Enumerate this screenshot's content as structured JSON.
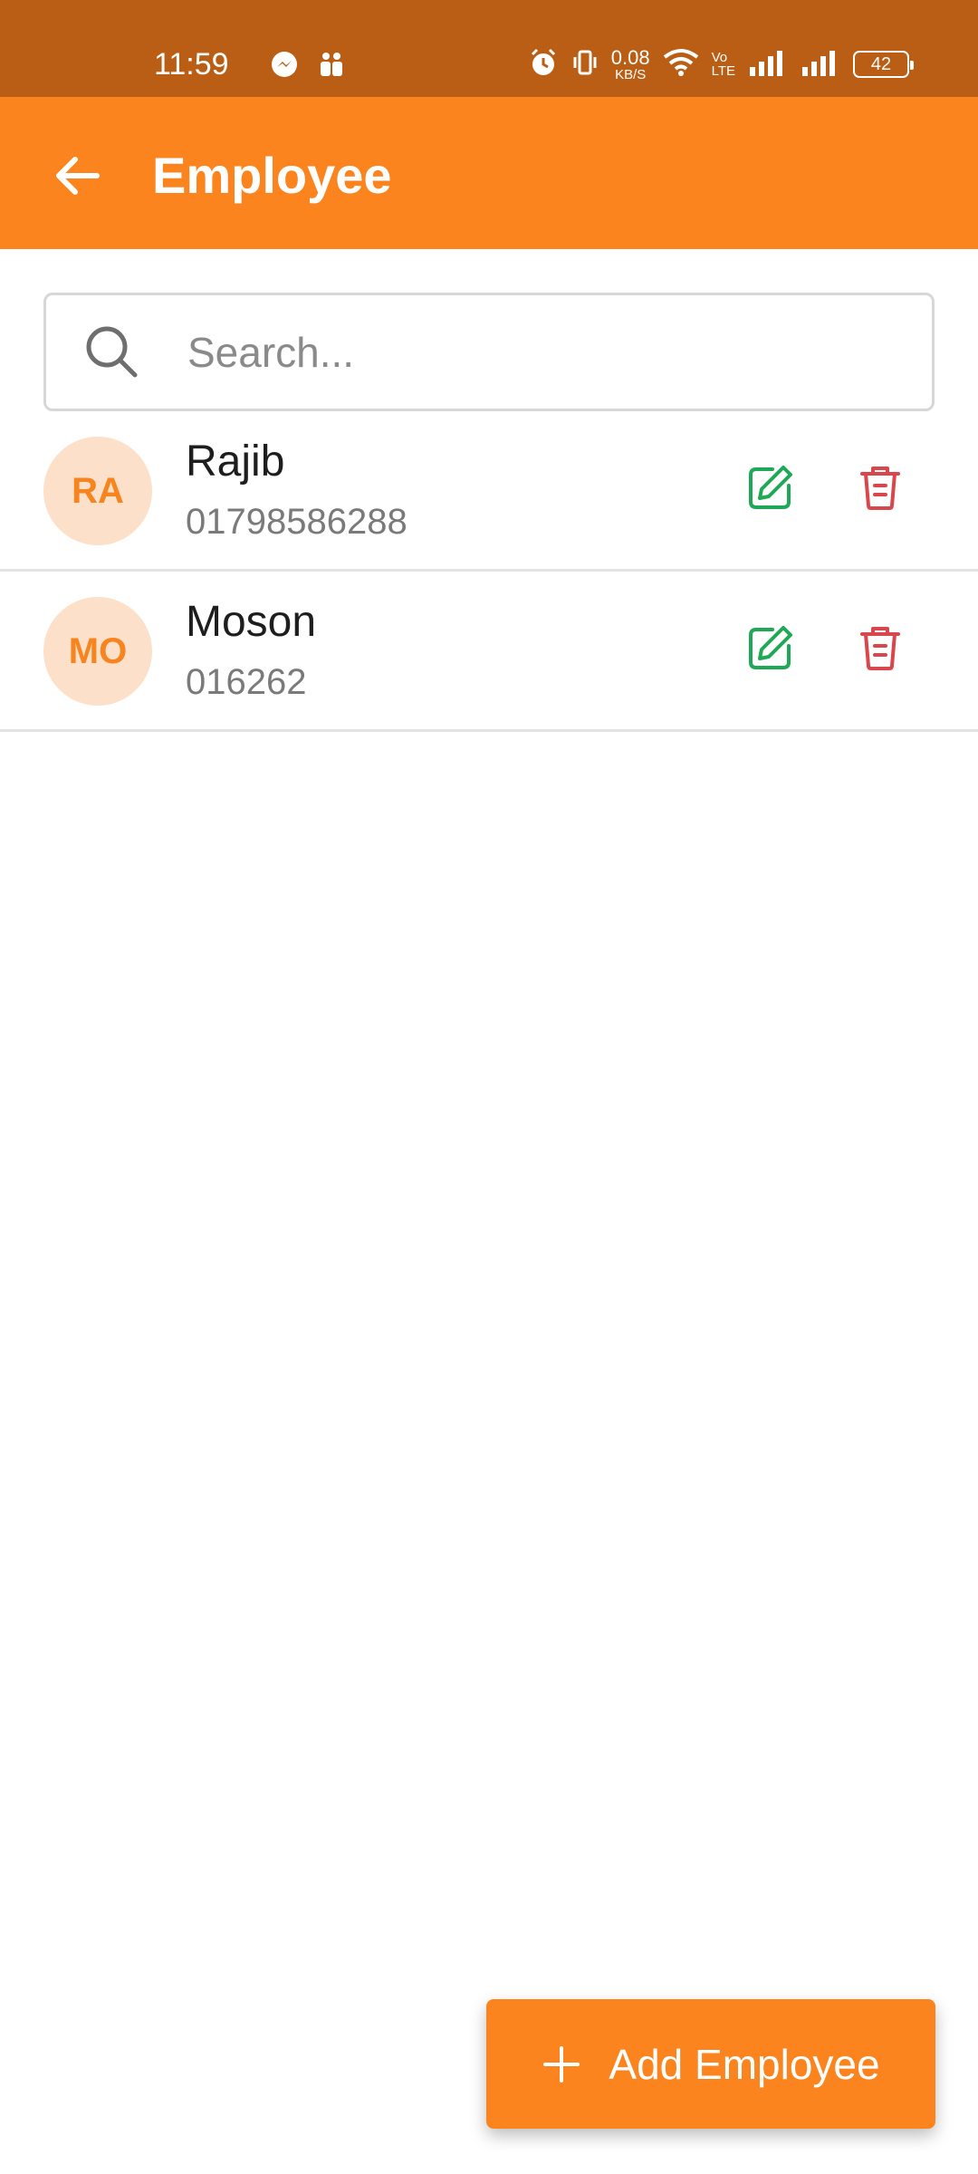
{
  "status_bar": {
    "time": "11:59",
    "net_speed_value": "0.08",
    "net_speed_unit": "KB/S",
    "volte_top": "Vo",
    "volte_bottom": "LTE",
    "battery": "42",
    "icons": [
      "messenger-icon",
      "teams-icon",
      "alarm-icon",
      "vibrate-icon",
      "wifi-icon",
      "signal-icon"
    ]
  },
  "app_bar": {
    "title": "Employee"
  },
  "search": {
    "placeholder": "Search...",
    "value": ""
  },
  "employees": [
    {
      "initials": "RA",
      "name": "Rajib",
      "phone": "01798586288"
    },
    {
      "initials": "MO",
      "name": "Moson",
      "phone": "016262"
    }
  ],
  "fab": {
    "label": "Add Employee"
  },
  "colors": {
    "status_bar": "#B95E14",
    "primary": "#FB841E",
    "avatar_bg": "#FDE0C9",
    "edit": "#1FA855",
    "delete": "#D9464B"
  }
}
